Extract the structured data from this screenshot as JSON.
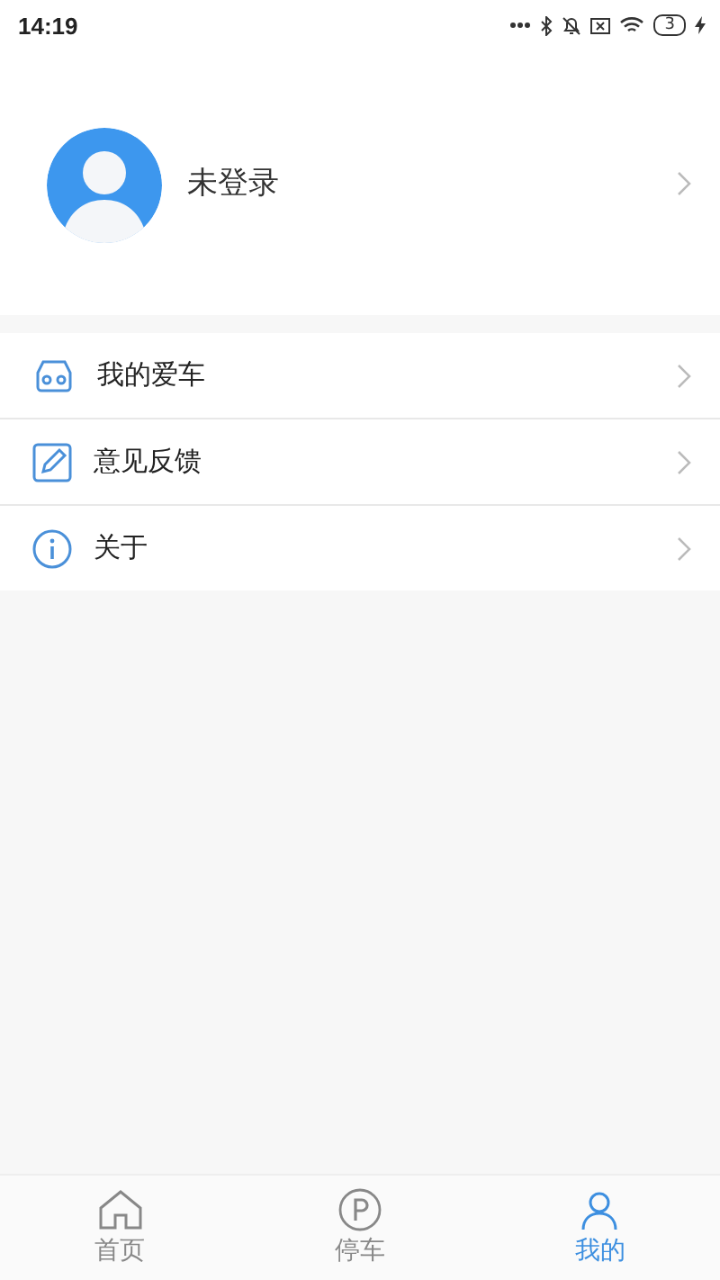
{
  "status_bar": {
    "time": "14:19",
    "battery": "3"
  },
  "profile": {
    "name": "未登录"
  },
  "menu": [
    {
      "label": "我的爱车"
    },
    {
      "label": "意见反馈"
    },
    {
      "label": "关于"
    }
  ],
  "tabs": [
    {
      "label": "首页",
      "selected": false
    },
    {
      "label": "停车",
      "selected": false
    },
    {
      "label": "我的",
      "selected": true
    }
  ]
}
